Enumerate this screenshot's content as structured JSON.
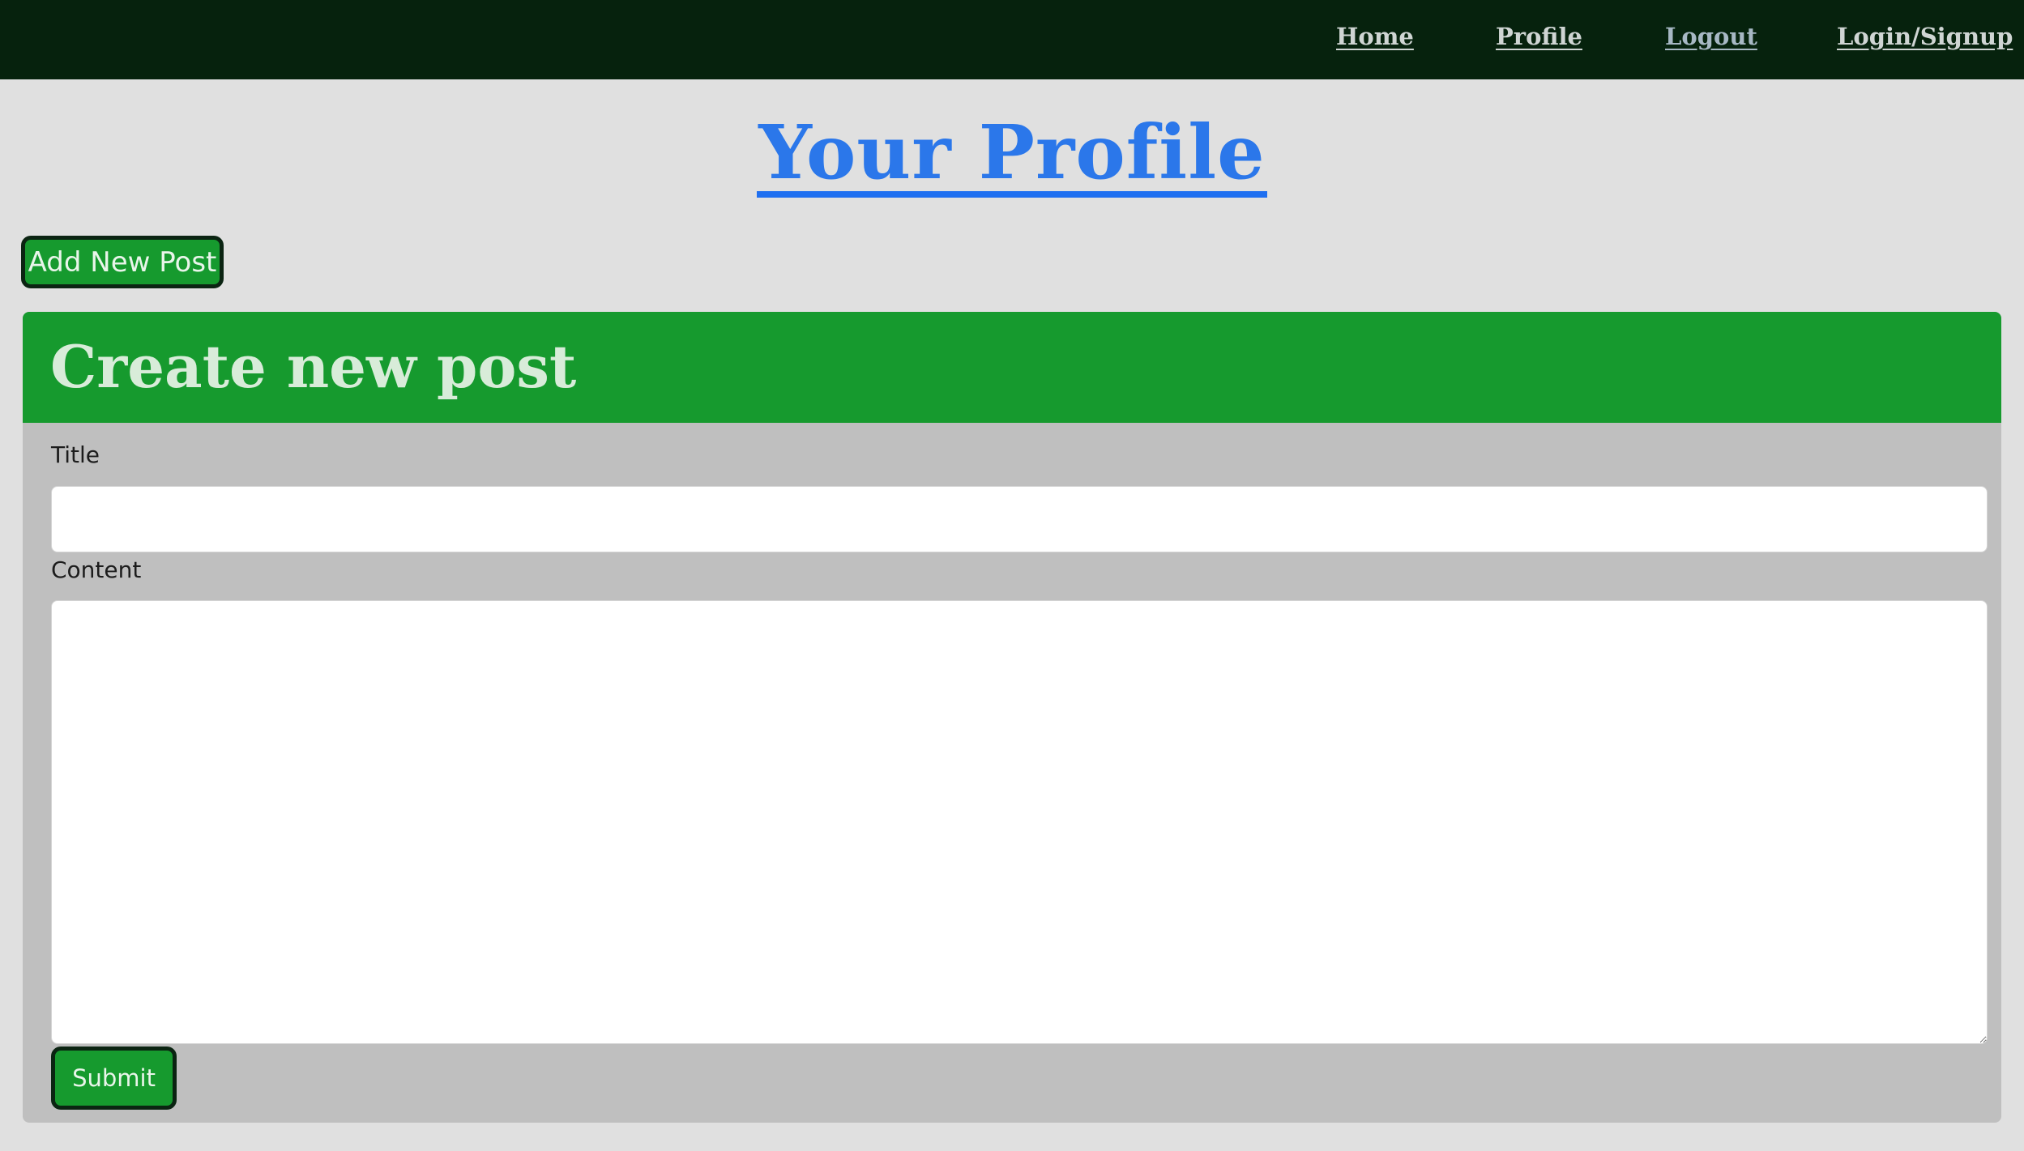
{
  "nav": {
    "items": [
      {
        "label": "Home"
      },
      {
        "label": "Profile"
      },
      {
        "label": "Logout"
      },
      {
        "label": "Login/Signup"
      }
    ]
  },
  "page": {
    "title": "Your Profile",
    "add_post_label": "Add New Post"
  },
  "form": {
    "header": "Create new post",
    "title_label": "Title",
    "title_value": "",
    "content_label": "Content",
    "content_value": "",
    "submit_label": "Submit"
  },
  "colors": {
    "navbar_bg": "#06220d",
    "page_bg": "#e0e0e0",
    "accent_green": "#169a2e",
    "title_blue": "#2b77ea",
    "card_bg": "#bfbfbf"
  }
}
